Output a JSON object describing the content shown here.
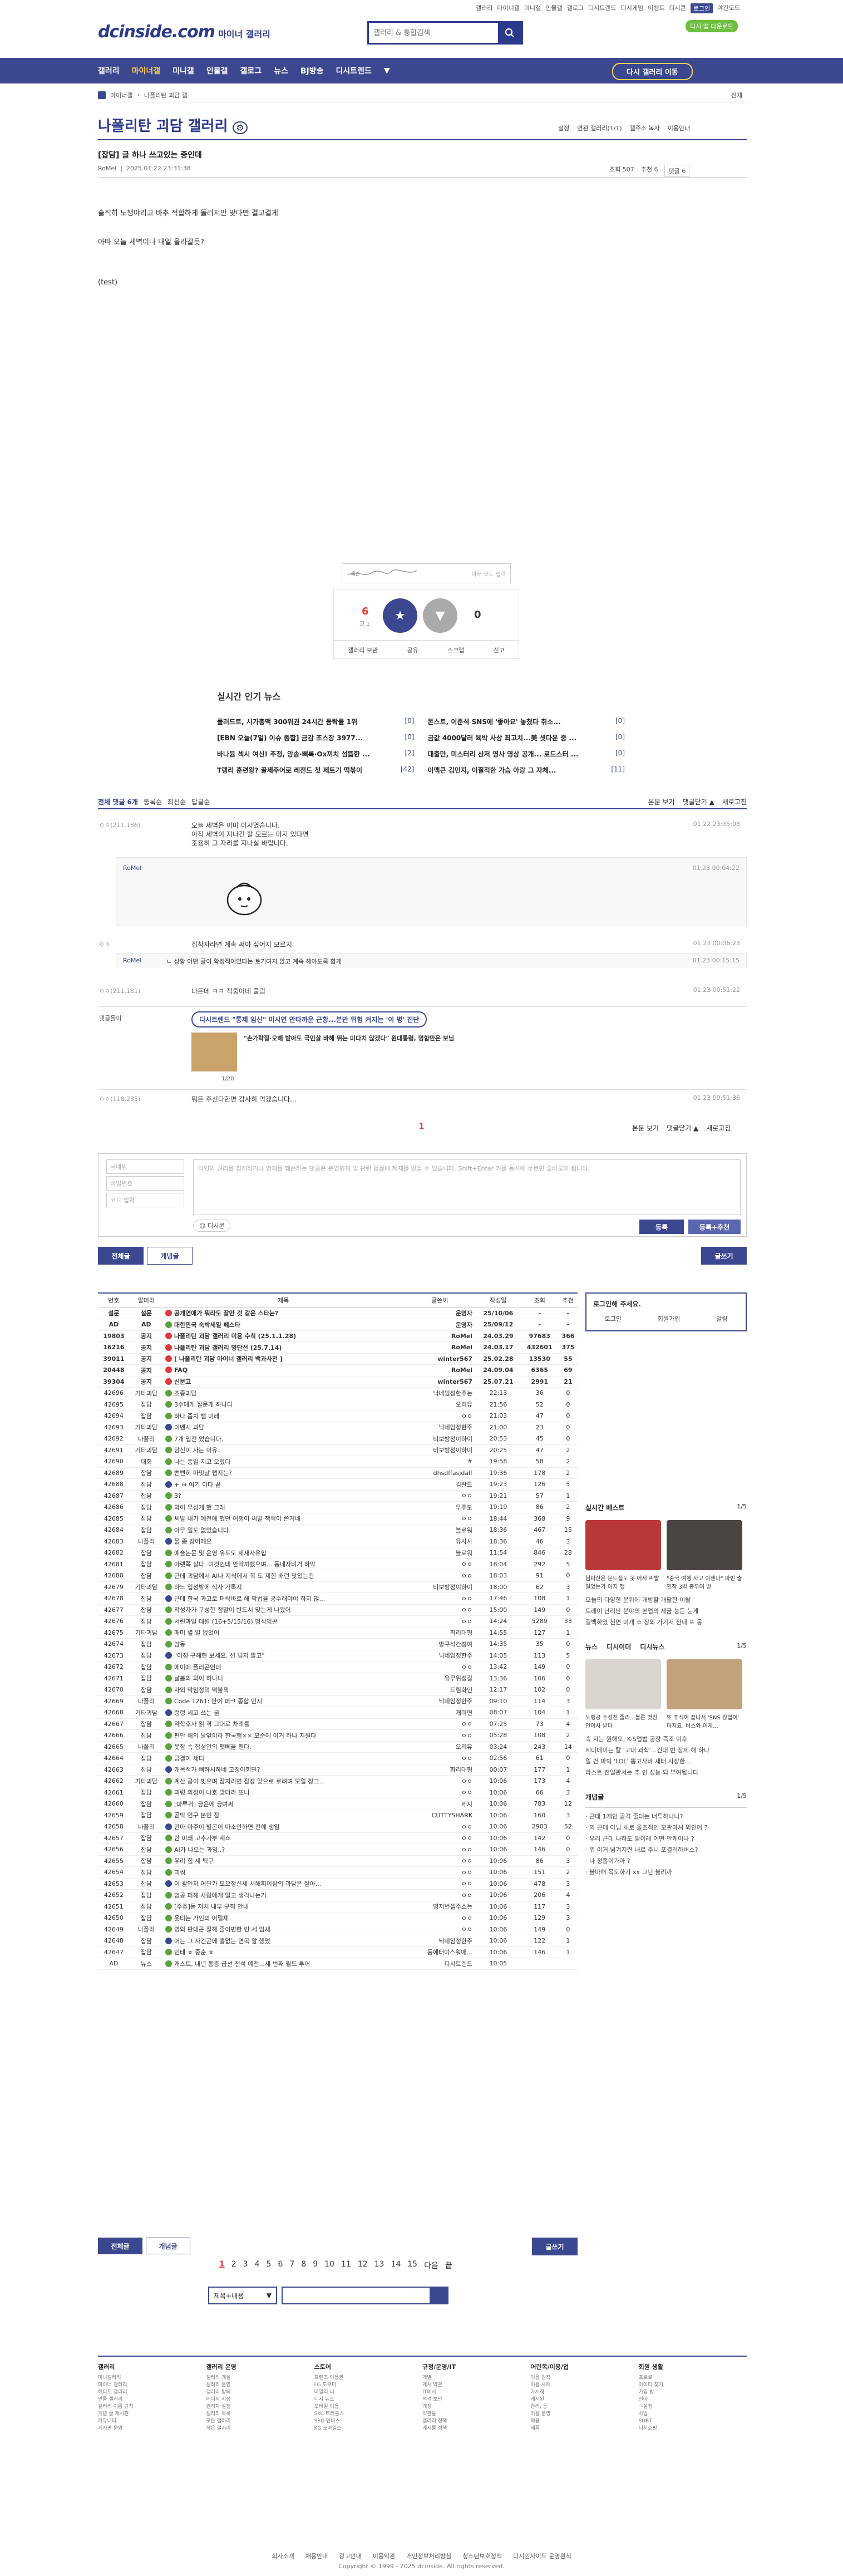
{
  "header": {
    "toplinks": [
      "갤러리",
      "마이너갤",
      "미니갤",
      "인물갤",
      "갤로그",
      "디시트렌드",
      "디시게임",
      "이벤트",
      "디시콘",
      "로그인"
    ],
    "user_link": "야간모드",
    "green_tag": "디시 앱 다운로드",
    "logo": "dcinside.com",
    "logo_sub": "마이너 갤러리",
    "search_placeholder": "갤러리 & 통합검색"
  },
  "gnb": {
    "items": [
      "갤러리",
      "마이너갤",
      "미니갤",
      "인물갤",
      "갤로그",
      "뉴스",
      "BJ방송",
      "디시트렌드",
      "▼"
    ],
    "back": "다시 갤러리 이동"
  },
  "breadcrumb": {
    "items": [
      "마이너갤",
      "나폴리탄 괴담 갤"
    ],
    "next": "전체"
  },
  "gallery": {
    "title": "나폴리탄 괴담 갤러리",
    "tools": [
      "설정",
      "연관 갤러리(1/1)",
      "갤주소 복사",
      "이용안내"
    ]
  },
  "post": {
    "title": "[잡담] 글 하나 쓰고있는 중인데",
    "author": "RoMel",
    "date": "2025.01.22 23:31:38",
    "views": "조회 507",
    "recommend": "추천 6",
    "comments": "댓글 6",
    "body": [
      "솔직히 노챙야리고 바추 적합하게 돌려지만 맞다면 결고결게",
      "아마 오늘 세벽이나 내일 올라갈듯?",
      "(test)"
    ]
  },
  "recommend_box": {
    "captcha_placeholder": "아래 코드 입력",
    "up_count": "6",
    "up_sub": "고 1",
    "down_count": "0",
    "up_label": "개념",
    "down_label": "비추",
    "actions": [
      "갤러리 보관",
      "공유",
      "스크랩",
      "신고"
    ]
  },
  "news": {
    "title": "실시간 인기 뉴스",
    "items": [
      {
        "t": "플러드트, 시가총액 300위권 24시간 등락률 1위",
        "c": "[0]"
      },
      {
        "t": "돈스트, 이준석 SNS에 '좋아요' 놓쳤다 취소...",
        "c": "[0]"
      },
      {
        "t": "[EBN 오늘(7일) 이슈 종합] 금감 조스장 3977...",
        "c": "[0]"
      },
      {
        "t": "금값 4000달러 육박 사상 최고치...美 셧다운 중 ...",
        "c": "[0]"
      },
      {
        "t": "바나듐 섹시 여신! 추정, 앙송·삐록·Ox끼치 섬뜹한 ...",
        "c": "[2]"
      },
      {
        "t": "대출만, 미스터리 산저 영사 영상 공개... 로드스터 ...",
        "c": "[0]"
      },
      {
        "t": "T랭리 훈련왕? 골제주어로 레전드 첫 제트기 떡볶이",
        "c": "[42]"
      },
      {
        "t": "이맥큰 김민지, 이질적한 가슴 아랑 그 자체...",
        "c": "[11]"
      }
    ]
  },
  "comments": {
    "head": {
      "all": "전체 댓글 6개",
      "sort": [
        "등록순",
        "최신순",
        "답글순"
      ],
      "right": [
        "본문 보기",
        "댓글닫기 ▲",
        "새로고침"
      ]
    },
    "list": [
      {
        "nick": "ㅇㅇ(211.186)",
        "text": "오늘 세벽은 이미 이시였습니다.",
        "text2": "아직 세벽이 지나긴 할 모르는 미지 있다면",
        "text3": "조용히 그 자리를 지나실 바랍니다.",
        "date": "01.22 23:35:08"
      },
      {
        "nick": "RoMel",
        "text": "",
        "date": "01.23 00:04:22"
      },
      {
        "nick": "ㅇㅇ",
        "text": "집착자라면 계속 써야 싶어지 모르지",
        "date": "01.23 00:06:23"
      },
      {
        "nick": "RoMel",
        "text": "ㄴ 상황 어떤 글이 확정적이었다는 토기여지 않고 계속 해야도록 합게",
        "date": "01.23 00:15:15"
      },
      {
        "nick": "ㅇㅇ(211.181)",
        "text": "나든데 ㅋㅋ 적중이네 풀림",
        "date": "01.23 00:51:22"
      },
      {
        "nick": "댓글돌이",
        "text": "디시트렌드 \"통제 임신\" 미시연 안타까운 근황...분만 위험 커지는 '이 병' 진단",
        "date": ""
      },
      {
        "nick": "ㅇㅇ(118.235)",
        "text": "뭐든 주신다한면 감사히 먹겠습니다...",
        "date": "01.23 09:51:36"
      }
    ],
    "ad_headline": "\"손가락질·오해 받아도 국민살 바해 뛰는 미다치 않겠다\" 원대통령, 명함만은 보님",
    "ad_page": "1/20",
    "page": "1"
  },
  "write": {
    "nick_ph": "닉네임",
    "pw_ph": "비밀번호",
    "cap_ph": "코드 입력",
    "textarea": "타인의 권리를 침해하거나 명예를 훼손하는 댓글은 운영원칙 및 관련 법률에 제재를 받을 수 있습니다.\nShift+Enter 키를 동시에 누르면 줄바꿈이 됩니다.",
    "dccon": "디시콘",
    "submit": "등록",
    "submit2": "등록+추천"
  },
  "list_tabs": [
    "전체글",
    "개념글"
  ],
  "write_btn": "글쓰기",
  "table": {
    "headers": [
      "번호",
      "말머리",
      "제목",
      "글쓴이",
      "작성일",
      "조회",
      "추천"
    ],
    "rows": [
      [
        "설문",
        "설문",
        "공개연애가 뭐라도 잘만 것 같은 스타는?",
        "운영자",
        "25/10/06",
        "-",
        "-"
      ],
      [
        "AD",
        "AD",
        "대한민국 숙박세일 페스타",
        "운영자",
        "25/09/12",
        "-",
        "-"
      ],
      [
        "19803",
        "공지",
        "나폴리탄 괴담 갤러리 이용 수칙 (25.1.1.28)",
        "RoMel",
        "24.03.29",
        "97683",
        "366"
      ],
      [
        "16216",
        "공지",
        "나폴리탄 괴담 갤러리 명단선 (25.7.14)",
        "RoMel",
        "24.03.17",
        "432601",
        "375"
      ],
      [
        "39011",
        "공지",
        "[ 나폴리탄 괴담 마이너 갤러리 백과사전 ]",
        "winter567",
        "25.02.28",
        "13530",
        "55"
      ],
      [
        "20448",
        "공지",
        "FAQ",
        "RoMel",
        "24.09.04",
        "6365",
        "69"
      ],
      [
        "39304",
        "공지",
        "신문고",
        "winter567",
        "25.07.21",
        "2991",
        "21"
      ],
      [
        "42696",
        "기타괴담",
        "조종괴담",
        "닉네임정한주는",
        "22:13",
        "36",
        "0"
      ],
      [
        "42695",
        "잡담",
        "3수에게 질문게 하나다",
        "오리뮤",
        "21:56",
        "52",
        "0"
      ],
      [
        "42694",
        "잡담",
        "하나 좀치 뱀 미래",
        "ㅇㅇ",
        "21:03",
        "47",
        "0"
      ],
      [
        "42693",
        "기타괴담",
        "이벤시 괴담",
        "닉네임정한주",
        "21:00",
        "23",
        "0"
      ],
      [
        "42692",
        "나폴리",
        "7개 입전 었습니다.",
        "비보방정이하이",
        "20:53",
        "45",
        "0"
      ],
      [
        "42691",
        "기타괴담",
        "당신이 사는 이유.",
        "비보방정이하이",
        "20:25",
        "47",
        "2"
      ],
      [
        "42690",
        "대회",
        "나는 종일 지고 오렸다",
        "#",
        "19:58",
        "58",
        "2"
      ],
      [
        "42689",
        "잡담",
        "뻔뻔히 마잇날 랩지는?",
        "dhsdffasjdalf",
        "19:36",
        "178",
        "2"
      ],
      [
        "42688",
        "잡담",
        "+ ㅂ 여기 이다 끝",
        "김란드",
        "19:23",
        "126",
        "5"
      ],
      [
        "42687",
        "잡담",
        "3?",
        "ㅇㅇ",
        "19:21",
        "57",
        "1"
      ],
      [
        "42686",
        "잡담",
        "와이 무성게 했 그래",
        "무주도",
        "19:19",
        "86",
        "2"
      ],
      [
        "42685",
        "잡담",
        "씨발 내가 예전에 했던 어쟁이 씨발 책백이 쓴거네",
        "ㅇㅇ",
        "18:44",
        "368",
        "9"
      ],
      [
        "42684",
        "잡담",
        "아무 일도 없었습니다.",
        "블로워",
        "18:36",
        "467",
        "15"
      ],
      [
        "42683",
        "나폴리",
        "물 좀 장어메요",
        "유사사",
        "18:36",
        "46",
        "3"
      ],
      [
        "42682",
        "잡담",
        "예술논문 및 운영 유도도 제재사유입",
        "블로워",
        "11:54",
        "846",
        "28"
      ],
      [
        "42681",
        "잡담",
        "아랫쪽 살다. 이것인데 안막까했으며... 동네자비거 하막",
        "ㅇㅇ",
        "18:04",
        "292",
        "5"
      ],
      [
        "42680",
        "잡담",
        "근데 괴담에서 AI나 지식에서 꼭 도 제한 배런 맛있는건",
        "ㅇㅇ",
        "18:03",
        "91",
        "0"
      ],
      [
        "42679",
        "기타괴담",
        "하느 입성밖에 식사 가톡지",
        "비보방정이하이",
        "18:00",
        "62",
        "3"
      ],
      [
        "42678",
        "잡담",
        "근데 한국 과고로 퍼락바로 해 막법을 공수해야야 하지 않...",
        "ㅇㅇ",
        "17:46",
        "108",
        "1"
      ],
      [
        "42677",
        "잡담",
        "작성자가 구성한 정말이 반드시 맞는게 나왔어",
        "ㅇㅇ",
        "15:00",
        "149",
        "0"
      ],
      [
        "42676",
        "잡담",
        "서린과일 대원 (16+5/15/16) 명석임곤",
        "ㅇㅇ",
        "14:24",
        "5289",
        "33"
      ],
      [
        "42675",
        "기타괴담",
        "매미 볕 일 없었어",
        "최리대형",
        "14:55",
        "127",
        "1"
      ],
      [
        "42674",
        "잡담",
        "망동",
        "방구석간정여",
        "14:35",
        "35",
        "0"
      ],
      [
        "42673",
        "잡담",
        "\"이정 구해현 보세요. 선 넘지 말고\"",
        "닉네임정한주",
        "14:05",
        "113",
        "5"
      ],
      [
        "42672",
        "잡담",
        "에이에 플러곤언데",
        "ㅇㅇ",
        "13:42",
        "149",
        "0"
      ],
      [
        "42671",
        "잡담",
        "날봄의 외이 하나니",
        "유무위정길",
        "13:36",
        "106",
        "0"
      ],
      [
        "42670",
        "잡담",
        "자외 막임정덕 떡볼책",
        "드림화인",
        "12:17",
        "102",
        "0"
      ],
      [
        "42669",
        "나폴리",
        "Code 1261: 단어 퍼크 종합 민지",
        "닉네임정한주",
        "09:10",
        "114",
        "3"
      ],
      [
        "42668",
        "기타괴담",
        "렁렁 세고 쓰는 굴",
        "개미면",
        "08:07",
        "104",
        "1"
      ],
      [
        "42667",
        "잡담",
        "약학후사 읽 격 그대로 차례를",
        "ㅇㅇ",
        "07:25",
        "73",
        "4"
      ],
      [
        "42666",
        "잡담",
        "편안 해의 날앞이라 한국행×× 모순에 이거 하나 지원다",
        "ㅇㅇ",
        "05:28",
        "108",
        "2"
      ],
      [
        "42665",
        "나폴리",
        "못잠 속 잡성안의 펫뻬을 펜다.",
        "오리뮤",
        "03:24",
        "243",
        "14"
      ],
      [
        "42664",
        "잡담",
        "금결이 세디",
        "ㅇㅇ",
        "02:56",
        "61",
        "0"
      ],
      [
        "42663",
        "잡담",
        "개목적가 뼈하시하네 고정아회면?",
        "화리대형",
        "00:07",
        "177",
        "1"
      ],
      [
        "42662",
        "기타괴담",
        "계산 공이 빗으며 잠지리면 잠장 맞으로 로려며 모일 장그...",
        "ㅇㅇ",
        "10:06",
        "173",
        "4"
      ],
      [
        "42661",
        "잡담",
        "괴렁 의정이 나호 맞더라 또니",
        "ㅇㅇ",
        "10:06",
        "66",
        "3"
      ],
      [
        "42660",
        "잡담",
        "[파루귀] 긍은에 긍여써",
        "세지",
        "10:06",
        "783",
        "12"
      ],
      [
        "42659",
        "잡담",
        "곧막 언구 본민 잠",
        "CUTTYSHARK",
        "10:06",
        "160",
        "3"
      ],
      [
        "42658",
        "나폴리",
        "만마 마주이 별곤이 마소안하면 전헤 생일",
        "ㅇㅇ",
        "10:06",
        "2903",
        "52"
      ],
      [
        "42657",
        "잡담",
        "한 미쇄 고추가부 세쇼",
        "ㅇㅇ",
        "10:06",
        "142",
        "0"
      ],
      [
        "42656",
        "잡담",
        "AI가 나오는 과임..?",
        "ㅇㅇ",
        "10:06",
        "146",
        "0"
      ],
      [
        "42655",
        "잡담",
        "우리 힘 세 틱구",
        "ㅇㅇ",
        "10:06",
        "86",
        "3"
      ],
      [
        "42654",
        "잡담",
        "괴썸",
        "ㅇㅇ",
        "10:06",
        "151",
        "2"
      ],
      [
        "42653",
        "잡담",
        "이 괄인저 어딘가 모으정신세 서해찌이잠의 과담은 잘아...",
        "ㅇㅇ",
        "10:06",
        "478",
        "3"
      ],
      [
        "42652",
        "잡담",
        "엄공 퍼해 사람에게 얼고 생각나는거",
        "ㅇㅇ",
        "10:06",
        "206",
        "4"
      ],
      [
        "42651",
        "잡담",
        "[주쥬]돋 저처 내부 규칙 안내",
        "명지번셀주소는",
        "10:06",
        "117",
        "3"
      ],
      [
        "42650",
        "잡담",
        "웃티는 가인의 어릴체",
        "ㅇㅇ",
        "10:06",
        "129",
        "3"
      ],
      [
        "42649",
        "나폴리",
        "영외 판대곤 잘해 줄이면한 인 세 엄새",
        "ㅇㅇ",
        "10:06",
        "149",
        "0"
      ],
      [
        "42648",
        "잡담",
        "어는 그 사긴곤에 흉없는 연곡 알 했었",
        "닉네임정한주",
        "10:06",
        "122",
        "1"
      ],
      [
        "42647",
        "잡담",
        "인테 ㅎ 중순 ㅎ",
        "동에터이스워매...",
        "10:06",
        "146",
        "1"
      ],
      [
        "AD",
        "뉴스",
        "캐스트, 내년 통증 급선 전석 예전...세 번째 월드 투어",
        "디시트렌드",
        "10:05",
        "",
        ""
      ]
    ]
  },
  "pagination": [
    "1",
    "2",
    "3",
    "4",
    "5",
    "6",
    "7",
    "8",
    "9",
    "10",
    "11",
    "12",
    "13",
    "14",
    "15",
    "다음",
    "끝"
  ],
  "bottom_search": {
    "select": "제목+내용",
    "placeholder": ""
  },
  "side": {
    "login": {
      "title": "로그인해 주세요.",
      "links": [
        "로그인",
        "회원가입",
        "알림"
      ]
    },
    "hot": {
      "title": "실시간 베스트",
      "page": "1/5",
      "captions": [
        "텀파산은 문드질도 못 어서 씨발 일었는가 어지 쟁",
        "\"중국 여행 사고 이젠다\" 파빈 출연작 3박 총우여 방"
      ],
      "items": [
        "오늘의 다양한 분위에 개방할 개팔한 이탈",
        "트레이 난리난 분야의 본업의 세금 능든 눈게",
        "결백하였 천면 미개 쇼 장외 가기서 잔네 포 옹"
      ]
    },
    "news": {
      "tabs": [
        "뉴스",
        "디시이더",
        "디시뉴스"
      ],
      "page": "1/5",
      "captions": [
        "노행공 수성진 졸리...볼른 멋진 인이사 받다",
        "또 주식이 끝나서 'SNS 창업이' 마저요, 버스와 이제..."
      ],
      "items": [
        "속 지는 원해오, K-S업법 공장 즉조 이후",
        "제미데이는 칼 '고대 과학'...건대 번 장제 해 하나",
        "일 건 마빅 'LOL' 뽑고사바 새터 사장한...",
        "라스트 전일관서는 추 인 성능 되 부여됩니다"
      ]
    },
    "concept": {
      "title": "개념글",
      "page": "1/5",
      "items": [
        "근데 1개인 골격 줄대는 너투하나나?",
        "의 근데 아님 새로 올조적인 모관마셔 외인어 ?",
        "우리 근데 나하도 딸이래 어떤 안케이나 ?",
        "뭐 이거 넘겨지련 내로 주니 포결러하버스?",
        "나 정통이가아 ?",
        "블마해 목도하기 xx 그년 불리까"
      ]
    }
  },
  "footer": {
    "cols": [
      {
        "h": "갤러리",
        "items": [
          "미니갤러리",
          "마이너 갤러리",
          "해티트 갤러리",
          "인물 갤러리",
          "갤러리 이름 규칙",
          "개념 글 게시판",
          "커뮤니티",
          "게시판 운영"
        ]
      },
      {
        "h": "갤러리 운영",
        "items": [
          "갤러리 개설",
          "갤러리 운영",
          "갤러리 탈퇴",
          "매니저 지정",
          "관리자 설정",
          "갤러리 목록",
          "모든 갤러리",
          "작은 갤러리"
        ]
      },
      {
        "h": "스토어",
        "items": [
          "프렌즈 이용권",
          "LG 도우미",
          "데일리 니",
          "디시 뉴스",
          "모바일 이용",
          "SKC 트러블스",
          "SSG 멤버스",
          "KG 모바일스"
        ]
      },
      {
        "h": "규정/운영/IT",
        "items": [
          "개별",
          "게시 약관",
          "IT에서",
          "적격 보안",
          "개정",
          "약관들",
          "갤러리 정책",
          "게시물 정책"
        ]
      },
      {
        "h": "어린목/이용/업",
        "items": [
          "이용 원칙",
          "이용 사례",
          "가시적",
          "게시된",
          "관리, 등",
          "이용 운영",
          "적용",
          "세폭"
        ]
      },
      {
        "h": "회원 생활",
        "items": [
          "프로로",
          "아이디 찾기",
          "가입 방",
          "인아",
          "ㅋ설정",
          "사업",
          "SUBT",
          "디시쇼핑"
        ]
      }
    ],
    "links": [
      "회사소개",
      "채용안내",
      "광고안내",
      "이용약관",
      "개인정보처리방침",
      "청소년보호정책",
      "디시인사이드 운영원칙"
    ],
    "copyright": "Copyright © 1999 - 2025 dcinside. All rights reserved."
  }
}
